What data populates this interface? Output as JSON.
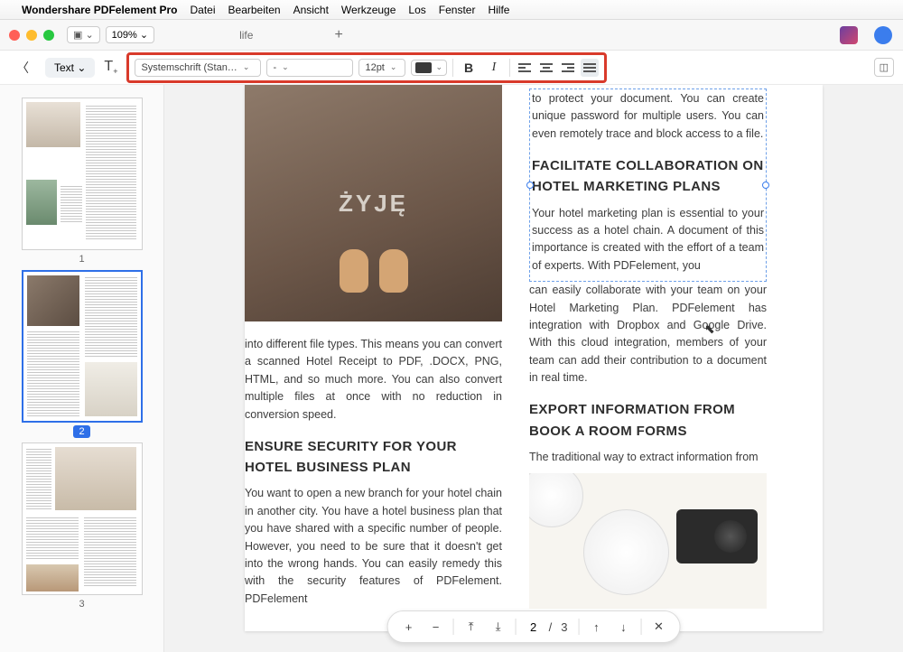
{
  "menu": {
    "apple": "",
    "app": "Wondershare PDFelement Pro",
    "items": [
      "Datei",
      "Bearbeiten",
      "Ansicht",
      "Werkzeuge",
      "Los",
      "Fenster",
      "Hilfe"
    ]
  },
  "win": {
    "zoom": "109% ⌄",
    "tab": "life"
  },
  "toolbar": {
    "mode": "Text ⌄",
    "font": "Systemschrift (Stan…",
    "weight": "-",
    "size": "12pt",
    "bold": "B",
    "italic": "I"
  },
  "doc": {
    "hero_text": "ŻYJĘ",
    "col1_p1": "into different file types. This means you can convert a scanned Hotel Receipt to PDF, .DOCX, PNG, HTML, and so much more. You can also convert multiple files at once with no reduction in conversion speed.",
    "col1_h1": "ENSURE SECURITY FOR YOUR HOTEL BUSINESS PLAN",
    "col1_p2": "You want to open a new branch for your hotel chain in another city. You have a hotel business plan that you have shared with a specific number of people. However, you need to be sure that it doesn't get into the wrong hands. You can easily remedy this with the security features of PDFelement. PDFelement",
    "col2_p1": "to protect your document. You can create unique password for multiple users. You can even remotely trace and block access to a file.",
    "col2_h1": "FACILITATE COLLABORATION ON HOTEL MARKETING PLANS",
    "col2_p2": "Your hotel marketing plan is essential to your success as a hotel chain. A document of this importance is created with the effort of a team of experts. With PDFelement, you",
    "col2_p3": "can easily collaborate with your team on your Hotel Marketing Plan. PDFelement has integration with Dropbox and Google Drive. With this cloud integration, members of your team can add their contribution to a document in real time.",
    "col2_h2": "EXPORT INFORMATION FROM BOOK A ROOM FORMS",
    "col2_p4": "The traditional way to extract information from"
  },
  "nav": {
    "page": "2",
    "total": "3"
  },
  "thumbs": [
    "1",
    "2",
    "3"
  ]
}
